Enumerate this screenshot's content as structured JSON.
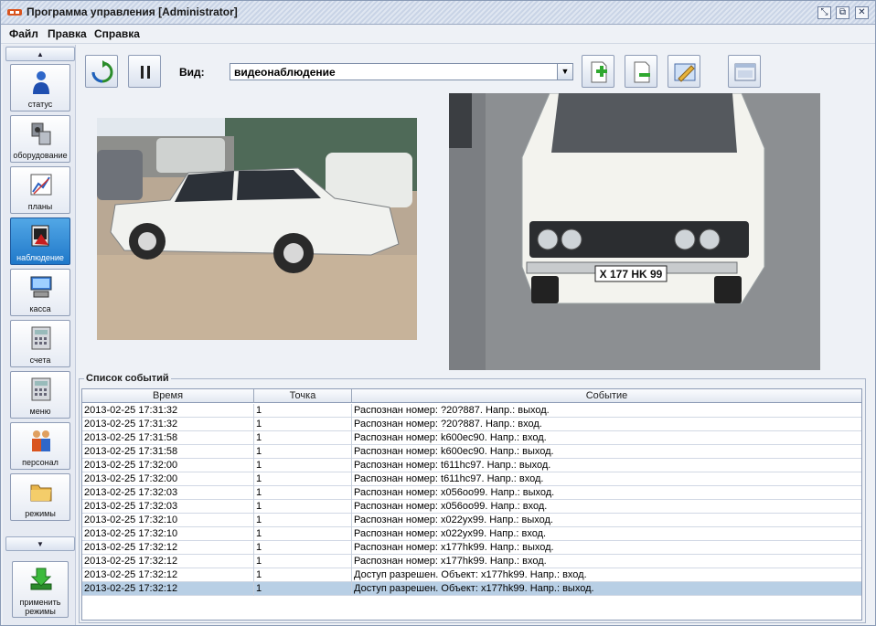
{
  "window": {
    "title": "Программа управления [Administrator]"
  },
  "menu": [
    "Файл",
    "Правка",
    "Справка"
  ],
  "sidebar": {
    "items": [
      {
        "label": "статус",
        "icon": "person-icon"
      },
      {
        "label": "оборудование",
        "icon": "equipment-icon"
      },
      {
        "label": "планы",
        "icon": "plans-icon"
      },
      {
        "label": "наблюдение",
        "icon": "surveillance-icon"
      },
      {
        "label": "касса",
        "icon": "cash-register-icon"
      },
      {
        "label": "счета",
        "icon": "calculator-icon"
      },
      {
        "label": "меню",
        "icon": "menu-calculator-icon"
      },
      {
        "label": "персонал",
        "icon": "staff-icon"
      },
      {
        "label": "режимы",
        "icon": "folder-icon"
      }
    ],
    "active_index": 3,
    "apply_label_1": "применить",
    "apply_label_2": "режимы"
  },
  "toolbar": {
    "view_label": "Вид:",
    "view_value": "видеонаблюдение"
  },
  "events": {
    "title": "Список событий",
    "columns": [
      "Время",
      "Точка",
      "Событие"
    ],
    "rows": [
      [
        "2013-02-25 17:31:32",
        "1",
        "Распознан номер: ?20?887. Напр.: выход."
      ],
      [
        "2013-02-25 17:31:32",
        "1",
        "Распознан номер: ?20?887. Напр.: вход."
      ],
      [
        "2013-02-25 17:31:58",
        "1",
        "Распознан номер: k600ec90. Напр.: вход."
      ],
      [
        "2013-02-25 17:31:58",
        "1",
        "Распознан номер: k600ec90. Напр.: выход."
      ],
      [
        "2013-02-25 17:32:00",
        "1",
        "Распознан номер: t611hc97. Напр.: выход."
      ],
      [
        "2013-02-25 17:32:00",
        "1",
        "Распознан номер: t611hc97. Напр.: вход."
      ],
      [
        "2013-02-25 17:32:03",
        "1",
        "Распознан номер: x056oo99. Напр.: выход."
      ],
      [
        "2013-02-25 17:32:03",
        "1",
        "Распознан номер: x056oo99. Напр.: вход."
      ],
      [
        "2013-02-25 17:32:10",
        "1",
        "Распознан номер: x022yx99. Напр.: выход."
      ],
      [
        "2013-02-25 17:32:10",
        "1",
        "Распознан номер: x022yx99. Напр.: вход."
      ],
      [
        "2013-02-25 17:32:12",
        "1",
        "Распознан номер: x177hk99. Напр.: выход."
      ],
      [
        "2013-02-25 17:32:12",
        "1",
        "Распознан номер: x177hk99. Напр.: вход."
      ],
      [
        "2013-02-25 17:32:12",
        "1",
        "Доступ разрешен. Объект: x177hk99. Напр.: вход."
      ],
      [
        "2013-02-25 17:32:12",
        "1",
        "Доступ разрешен. Объект: x177hk99. Напр.: выход."
      ]
    ],
    "selected_row": 13
  },
  "camera": {
    "plate_text": "X 177 HK 99"
  }
}
